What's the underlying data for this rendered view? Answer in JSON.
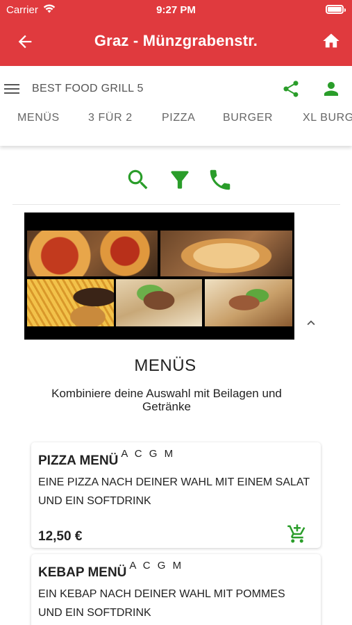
{
  "status_bar": {
    "carrier": "Carrier",
    "time": "9:27 PM"
  },
  "app_bar": {
    "title": "Graz - Münzgrabenstr."
  },
  "shop": {
    "name": "BEST FOOD GRILL 5"
  },
  "tabs": [
    "MENÜS",
    "3 FÜR 2",
    "PIZZA",
    "BURGER",
    "XL BURGER"
  ],
  "section": {
    "title": "MENÜS",
    "subtitle": "Kombiniere deine Auswahl mit Beilagen und Getränke"
  },
  "items": [
    {
      "name": "PIZZA MENÜ",
      "allergens": "A C G M",
      "description": "EINE PIZZA NACH DEINER WAHL MIT EINEM SALAT UND EIN SOFTDRINK",
      "price": "12,50 €"
    },
    {
      "name": "KEBAP MENÜ",
      "allergens": "A C G M",
      "description": "EIN KEBAP NACH DEINER WAHL MIT POMMES UND EIN SOFTDRINK"
    }
  ],
  "icons": {
    "back": "arrow-back-icon",
    "home": "home-icon",
    "menu": "hamburger-menu-icon",
    "share": "share-icon",
    "user": "account-icon",
    "search": "search-icon",
    "filter": "filter-icon",
    "call": "phone-icon",
    "collapse": "chevron-up-icon",
    "add_to_cart": "add-shopping-cart-icon"
  },
  "colors": {
    "brand_red": "#e03a3e",
    "accent_green": "#2a9d2a",
    "text_dark": "#222222",
    "text_muted": "#666666"
  }
}
